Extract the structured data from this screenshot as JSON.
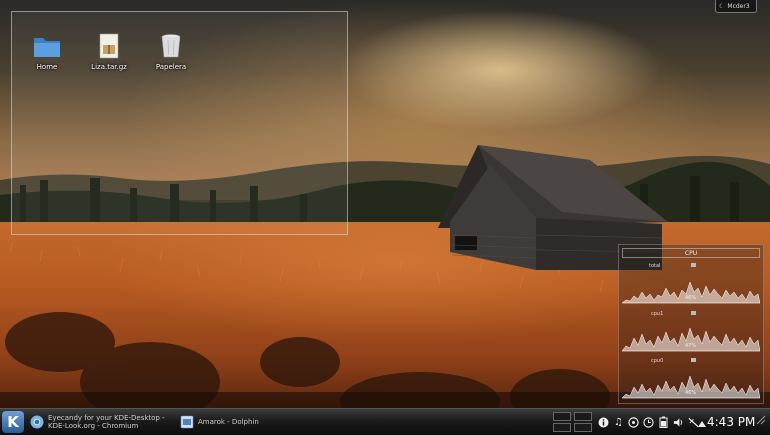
{
  "desktop": {
    "icons": [
      {
        "label": "Home",
        "icon": "folder-icon"
      },
      {
        "label": "Liza.tar.gz",
        "icon": "archive-icon"
      },
      {
        "label": "Papelera",
        "icon": "trash-icon"
      }
    ]
  },
  "user_widget": {
    "label": "Mcder3"
  },
  "cpu_widget": {
    "title": "CPU",
    "graphs": [
      {
        "name": "total",
        "value": "46%"
      },
      {
        "name": "cpu1",
        "value": "47%"
      },
      {
        "name": "cpu0",
        "value": "46%"
      }
    ]
  },
  "taskbar": {
    "tasks": [
      {
        "label": "Eyecandy for your KDE-Desktop - KDE-Look.org - Chromium",
        "icon": "chromium-icon"
      },
      {
        "label": "Amarok - Dolphin",
        "icon": "dolphin-icon"
      }
    ],
    "tray": [
      "info-icon",
      "music-note-icon",
      "klipper-icon",
      "clock-icon",
      "battery-icon",
      "volume-icon",
      "network-icon"
    ],
    "clock": "4:43 PM"
  },
  "colors": {
    "accent": "#2a5b9a",
    "panel": "#1c1c1c"
  }
}
